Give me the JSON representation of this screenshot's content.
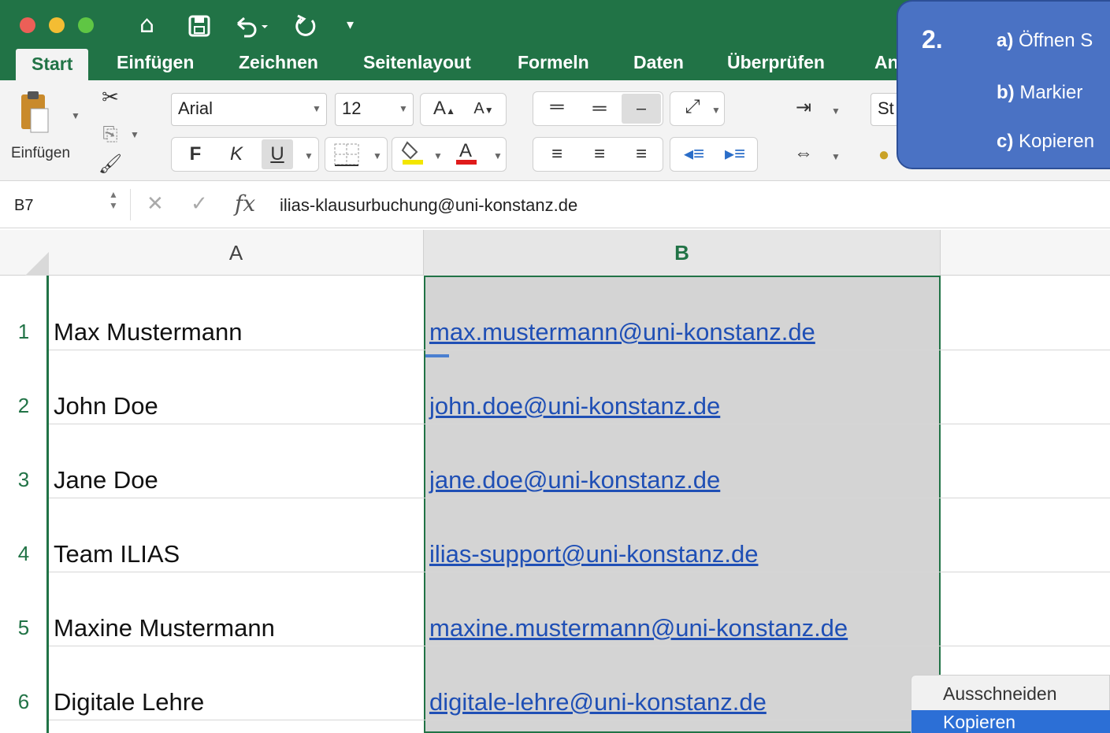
{
  "quick_access": {
    "icons": [
      "close-window-icon",
      "minimize-window-icon",
      "zoom-window-icon",
      "home-icon",
      "save-icon",
      "undo-icon",
      "redo-icon",
      "customize-toolbar-icon"
    ]
  },
  "tabs": [
    {
      "label": "Start",
      "active": true
    },
    {
      "label": "Einfügen"
    },
    {
      "label": "Zeichnen"
    },
    {
      "label": "Seitenlayout"
    },
    {
      "label": "Formeln"
    },
    {
      "label": "Daten"
    },
    {
      "label": "Überprüfen"
    },
    {
      "label": "An"
    }
  ],
  "ribbon": {
    "paste_label": "Einfügen",
    "font_name": "Arial",
    "font_size": "12",
    "bold": "F",
    "italic": "K",
    "underline": "U",
    "styles_partial": "St"
  },
  "formula_bar": {
    "name_box": "B7",
    "fx": "fx",
    "value": "ilias-klausurbuchung@uni-konstanz.de"
  },
  "columns": [
    "A",
    "B"
  ],
  "rows": [
    {
      "num": "1",
      "name": "Max Mustermann",
      "email": "max.mustermann@uni-konstanz.de"
    },
    {
      "num": "2",
      "name": "John Doe",
      "email": "john.doe@uni-konstanz.de"
    },
    {
      "num": "3",
      "name": "Jane Doe",
      "email": "jane.doe@uni-konstanz.de"
    },
    {
      "num": "4",
      "name": "Team ILIAS",
      "email": "ilias-support@uni-konstanz.de"
    },
    {
      "num": "5",
      "name": "Maxine Mustermann",
      "email": "maxine.mustermann@uni-konstanz.de"
    },
    {
      "num": "6",
      "name": "Digitale Lehre",
      "email": "digitale-lehre@uni-konstanz.de"
    }
  ],
  "callout": {
    "number": "2.",
    "steps": [
      {
        "key": "a)",
        "text": "Öffnen S"
      },
      {
        "key": "b)",
        "text": "Markier"
      },
      {
        "key": "c)",
        "text": "Kopieren"
      }
    ]
  },
  "context_menu": {
    "items": [
      {
        "label": "Ausschneiden"
      },
      {
        "label": "Kopieren",
        "highlighted": true
      }
    ]
  },
  "colors": {
    "excel_green": "#217346",
    "callout_blue": "#4a72c4",
    "link_blue": "#1f4fb5",
    "selection_gray": "#d4d4d4",
    "menu_highlight": "#2c6fd6"
  }
}
